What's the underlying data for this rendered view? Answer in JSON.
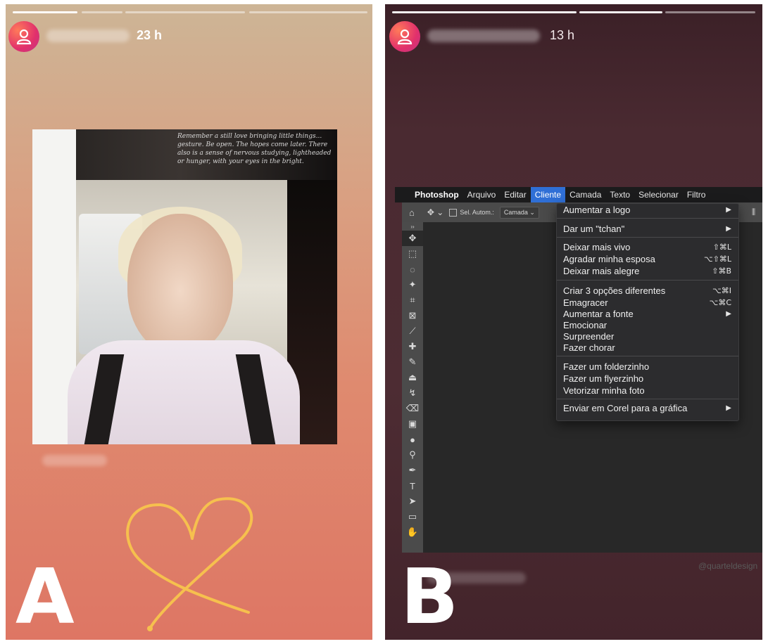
{
  "panel_a": {
    "time": "23 h",
    "letter": "A",
    "photo_text": "Remember a still love bringing little things... gesture. Be open. The hopes come later. There also is a sense of nervous studying, lightheaded or hunger, with your eyes in the bright."
  },
  "panel_b": {
    "time": "13 h",
    "letter": "B",
    "menubar": [
      "Photoshop",
      "Arquivo",
      "Editar",
      "Cliente",
      "Camada",
      "Texto",
      "Selecionar",
      "Filtro"
    ],
    "options_bar": {
      "auto_select_label": "Sel. Autom.:",
      "layer_select": "Camada"
    },
    "menu": {
      "items": [
        {
          "label": "Aumentar a logo",
          "shortcut": "",
          "submenu": true
        },
        {
          "label": "Dar um \"tchan\"",
          "shortcut": "",
          "submenu": true
        },
        {
          "label": "Deixar mais vivo",
          "shortcut": "⇧⌘L",
          "submenu": false
        },
        {
          "label": "Agradar minha esposa",
          "shortcut": "⌥⇧⌘L",
          "submenu": false
        },
        {
          "label": "Deixar mais alegre",
          "shortcut": "⇧⌘B",
          "submenu": false
        },
        {
          "label": "Criar 3 opções diferentes",
          "shortcut": "⌥⌘I",
          "submenu": false
        },
        {
          "label": "Emagracer",
          "shortcut": "⌥⌘C",
          "submenu": false
        },
        {
          "label": "Aumentar a fonte",
          "shortcut": "",
          "submenu": true
        },
        {
          "label": "Emocionar",
          "shortcut": "",
          "submenu": false
        },
        {
          "label": "Surpreender",
          "shortcut": "",
          "submenu": false
        },
        {
          "label": "Fazer chorar",
          "shortcut": "",
          "submenu": false
        },
        {
          "label": "Fazer um folderzinho",
          "shortcut": "",
          "submenu": false
        },
        {
          "label": "Fazer um flyerzinho",
          "shortcut": "",
          "submenu": false
        },
        {
          "label": "Vetorizar minha foto",
          "shortcut": "",
          "submenu": false
        },
        {
          "label": "Enviar em Corel para a gráfica",
          "shortcut": "",
          "submenu": true
        }
      ]
    },
    "watermark": "@quarteldesign"
  }
}
